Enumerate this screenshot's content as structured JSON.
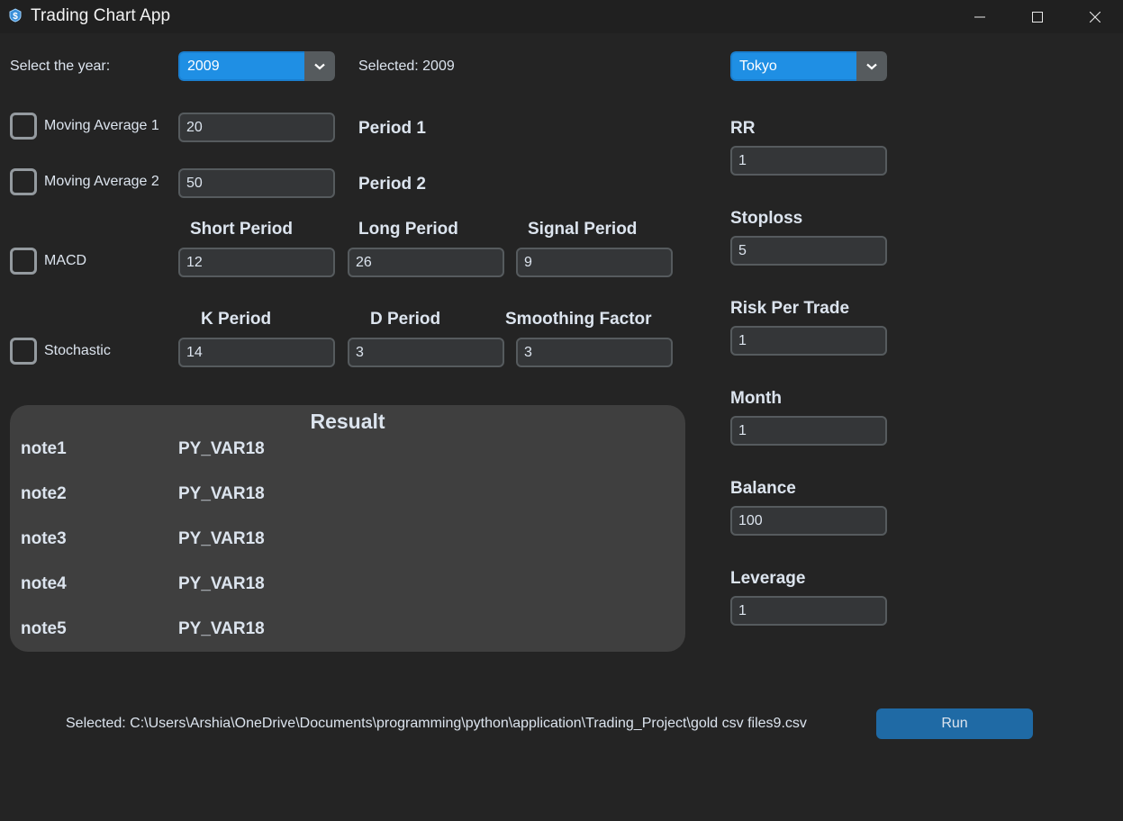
{
  "window": {
    "title": "Trading Chart App",
    "icon": "app-icon"
  },
  "year": {
    "label": "Select the year:",
    "value": "2009",
    "selected_text": "Selected: 2009"
  },
  "session": {
    "value": "Tokyo"
  },
  "ma1": {
    "label": "Moving Average 1",
    "value": "20",
    "period_label": "Period 1",
    "checked": false
  },
  "ma2": {
    "label": "Moving Average 2",
    "value": "50",
    "period_label": "Period 2",
    "checked": false
  },
  "macd": {
    "label": "MACD",
    "short_label": "Short Period",
    "long_label": "Long Period",
    "signal_label": "Signal Period",
    "short_value": "12",
    "long_value": "26",
    "signal_value": "9",
    "checked": false
  },
  "stochastic": {
    "label": "Stochastic",
    "k_label": "K Period",
    "d_label": "D Period",
    "smooth_label": "Smoothing Factor",
    "k_value": "14",
    "d_value": "3",
    "smooth_value": "3",
    "checked": false
  },
  "right_panel": {
    "rr_label": "RR",
    "rr_value": "1",
    "stoploss_label": "Stoploss",
    "stoploss_value": "5",
    "risk_label": "Risk Per Trade",
    "risk_value": "1",
    "month_label": "Month",
    "month_value": "1",
    "balance_label": "Balance",
    "balance_value": "100",
    "leverage_label": "Leverage",
    "leverage_value": "1"
  },
  "result": {
    "title": "Resualt",
    "notes": [
      {
        "name": "note1",
        "value": "PY_VAR18"
      },
      {
        "name": "note2",
        "value": "PY_VAR18"
      },
      {
        "name": "note3",
        "value": "PY_VAR18"
      },
      {
        "name": "note4",
        "value": "PY_VAR18"
      },
      {
        "name": "note5",
        "value": "PY_VAR18"
      }
    ]
  },
  "footer": {
    "file_text": "Selected: C:\\Users\\Arshia\\OneDrive\\Documents\\programming\\python\\application\\Trading_Project\\gold csv files9.csv",
    "run_label": "Run"
  },
  "colors": {
    "background": "#242424",
    "accent": "#1f8fe4",
    "button": "#1f6aa5",
    "panel": "#3f3f3f"
  }
}
